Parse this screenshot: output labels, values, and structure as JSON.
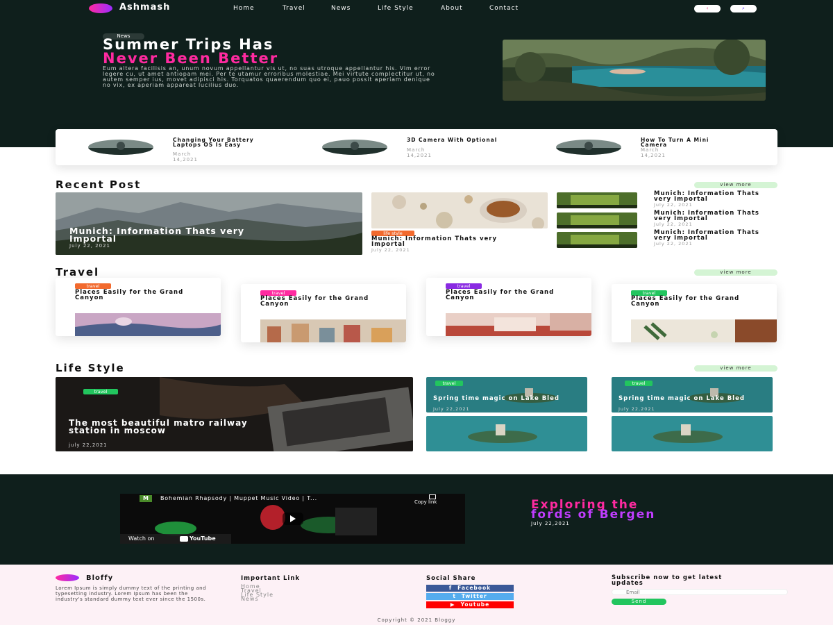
{
  "nav": {
    "brand": "Ashmash",
    "links": [
      "Home",
      "Travel",
      "News",
      "Life Style",
      "About",
      "Contact"
    ],
    "share_icon": "share-icon",
    "search_icon": "search-icon",
    "share_glyph": "‹",
    "search_glyph": "⌕"
  },
  "hero": {
    "tag": "News",
    "title_line1": "Summer Trips Has",
    "title_line2": "Never Been Better",
    "description": "Eum altera facilisis an, unum novum appellantur vis ut, no suas utroque appellantur his. Vim error legere cu, ut amet antiopam mei. Per te utamur erroribus molestiae. Mei virtute complectitur ut, no autem semper ius, movet adipisci his. Torquatos quaerendum quo ei, pauo possit aperiam denique no vix, ex aperiam appareat lucilius duo.",
    "accent": "#ff2aa0"
  },
  "featured": [
    {
      "title": "Changing Your Battery Laptops OS Is Easy",
      "date": "March 14,2021"
    },
    {
      "title": "3D Camera With Optional",
      "date": "March 14,2021"
    },
    {
      "title": "How To Turn A Mini Camera",
      "date": "March 14,2021"
    }
  ],
  "recent": {
    "heading": "Recent Post",
    "view_more": "view more",
    "main": {
      "title": "Munich: Information Thats very Importal",
      "date": "July 22, 2021"
    },
    "mid": {
      "tag": "life style",
      "title": "Munich: Information Thats very Importal",
      "date": "July 22, 2021"
    },
    "side": [
      {
        "title": "Munich: Information Thats very Importal",
        "date": "July 22, 2021"
      },
      {
        "title": "Munich: Information Thats very Importal",
        "date": "July 22, 2021"
      },
      {
        "title": "Munich: Information Thats very Importal",
        "date": "July 22, 2021"
      }
    ]
  },
  "travel": {
    "heading": "Travel",
    "view_more": "view more",
    "cards": [
      {
        "tag": "travel",
        "tag_color": "#f26a2e",
        "title": "Places Easily for the Grand Canyon"
      },
      {
        "tag": "travel",
        "tag_color": "#ff2aa0",
        "title": "Places Easily for the Grand Canyon"
      },
      {
        "tag": "travel",
        "tag_color": "#8a2be2",
        "title": "Places Easily for the Grand Canyon"
      },
      {
        "tag": "travel",
        "tag_color": "#22c55e",
        "title": "Places Easily for the Grand Canyon"
      }
    ]
  },
  "lifestyle": {
    "heading": "Life Style",
    "view_more": "view more",
    "main": {
      "tag": "travel",
      "title": "The most beautiful matro railway station in moscow",
      "date": "july 22,2021"
    },
    "small": [
      {
        "tag": "travel",
        "title": "Spring time magic on Lake Bled",
        "date": "July 22,2021"
      },
      {
        "tag": "travel",
        "title": "Spring time magic on Lake Bled",
        "date": "July 22,2021"
      }
    ]
  },
  "video": {
    "channel_logo": "M",
    "title": "Bohemian Rhapsody | Muppet Music Video | T...",
    "copy_link": "Copy link",
    "watch_on": "Watch on",
    "youtube": "YouTube",
    "heading_line1": "Exploring the",
    "heading_line2": "fords of Bergen",
    "date": "July 22,2021"
  },
  "footer": {
    "brand": "Bloffy",
    "about": "Lorem Ipsum is simply dummy text of the printing and typesetting industry. Lorem Ipsum has been the industry's standard dummy text ever since the 1500s.",
    "links_heading": "Important Link",
    "links": [
      "Home",
      "Travel",
      "Life Style",
      "News"
    ],
    "social_heading": "Social Share",
    "social": [
      {
        "label": "Facebook",
        "icon": "f",
        "color": "#3b5998"
      },
      {
        "label": "Twitter",
        "icon": "t",
        "color": "#55acee"
      },
      {
        "label": "Youtube",
        "icon": "▶",
        "color": "#ff0000"
      }
    ],
    "subscribe_heading": "Subscribe now to get latest updates",
    "email_placeholder": "Email",
    "send_label": "Send",
    "copyright": "Copyright © 2021 Bloggy"
  }
}
